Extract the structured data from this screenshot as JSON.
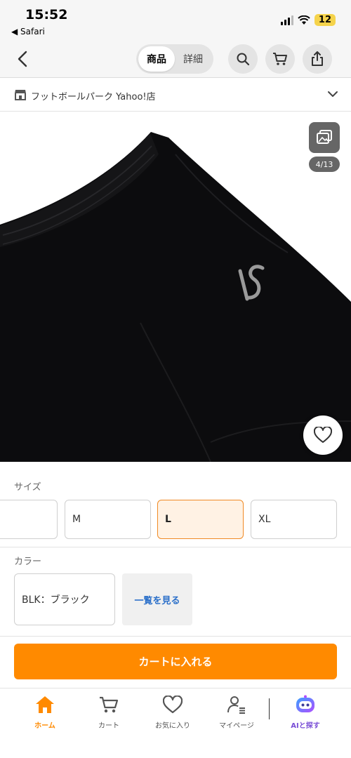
{
  "status": {
    "time": "15:52",
    "back_app": "◀ Safari",
    "battery": "12"
  },
  "nav": {
    "tabs": [
      {
        "label": "商品",
        "active": true
      },
      {
        "label": "詳細",
        "active": false
      }
    ]
  },
  "store": {
    "name": "フットボールパーク Yahoo!店"
  },
  "image": {
    "page_counter": "4/13"
  },
  "size": {
    "label": "サイズ",
    "options": [
      {
        "label": ""
      },
      {
        "label": "M"
      },
      {
        "label": "L",
        "selected": true
      },
      {
        "label": "XL"
      }
    ]
  },
  "color": {
    "label": "カラー",
    "option": "BLK：ブラック",
    "see_all": "一覧を見る"
  },
  "cart_button": "カートに入れる",
  "tabbar": {
    "items": [
      {
        "label": "ホーム",
        "icon": "home-icon",
        "active": true
      },
      {
        "label": "カート",
        "icon": "cart-icon"
      },
      {
        "label": "お気に入り",
        "icon": "heart-icon"
      },
      {
        "label": "マイページ",
        "icon": "user-icon"
      },
      {
        "label": "AIと探す",
        "icon": "ai-bot-icon"
      }
    ]
  },
  "colors": {
    "accent": "#ff8a00",
    "selected_border": "#f08a24",
    "selected_bg": "#fff2e4",
    "link": "#2a6fc9"
  }
}
